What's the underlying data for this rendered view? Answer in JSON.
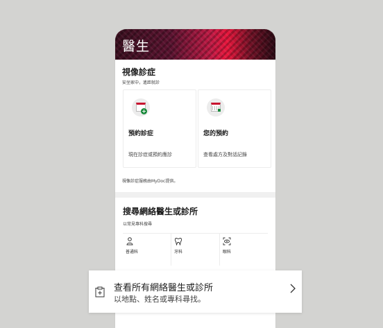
{
  "banner": {
    "title": "醫生"
  },
  "video": {
    "heading": "視像診症",
    "subtitle": "安坐家中，遙距就診",
    "cards": [
      {
        "title": "預約診症",
        "desc": "現在診症或預約應診",
        "icon": "calendar-plus-icon"
      },
      {
        "title": "您的預約",
        "desc": "查看處方及對話記錄",
        "icon": "calendar-check-icon"
      }
    ],
    "provider_note": "視像診症服務由MyDoc提供。"
  },
  "search": {
    "heading": "搜尋網絡醫生或診所",
    "subtitle": "以常見專科搜尋",
    "specialties": [
      {
        "label": "普通科",
        "icon": "stethoscope-icon"
      },
      {
        "label": "牙科",
        "icon": "tooth-icon"
      },
      {
        "label": "眼科",
        "icon": "eye-scan-icon"
      }
    ]
  },
  "sheet": {
    "title": "查看所有網絡醫生或診所",
    "subtitle": "以地點、姓名或專科尋找。",
    "icon": "clipboard-plus-icon"
  }
}
